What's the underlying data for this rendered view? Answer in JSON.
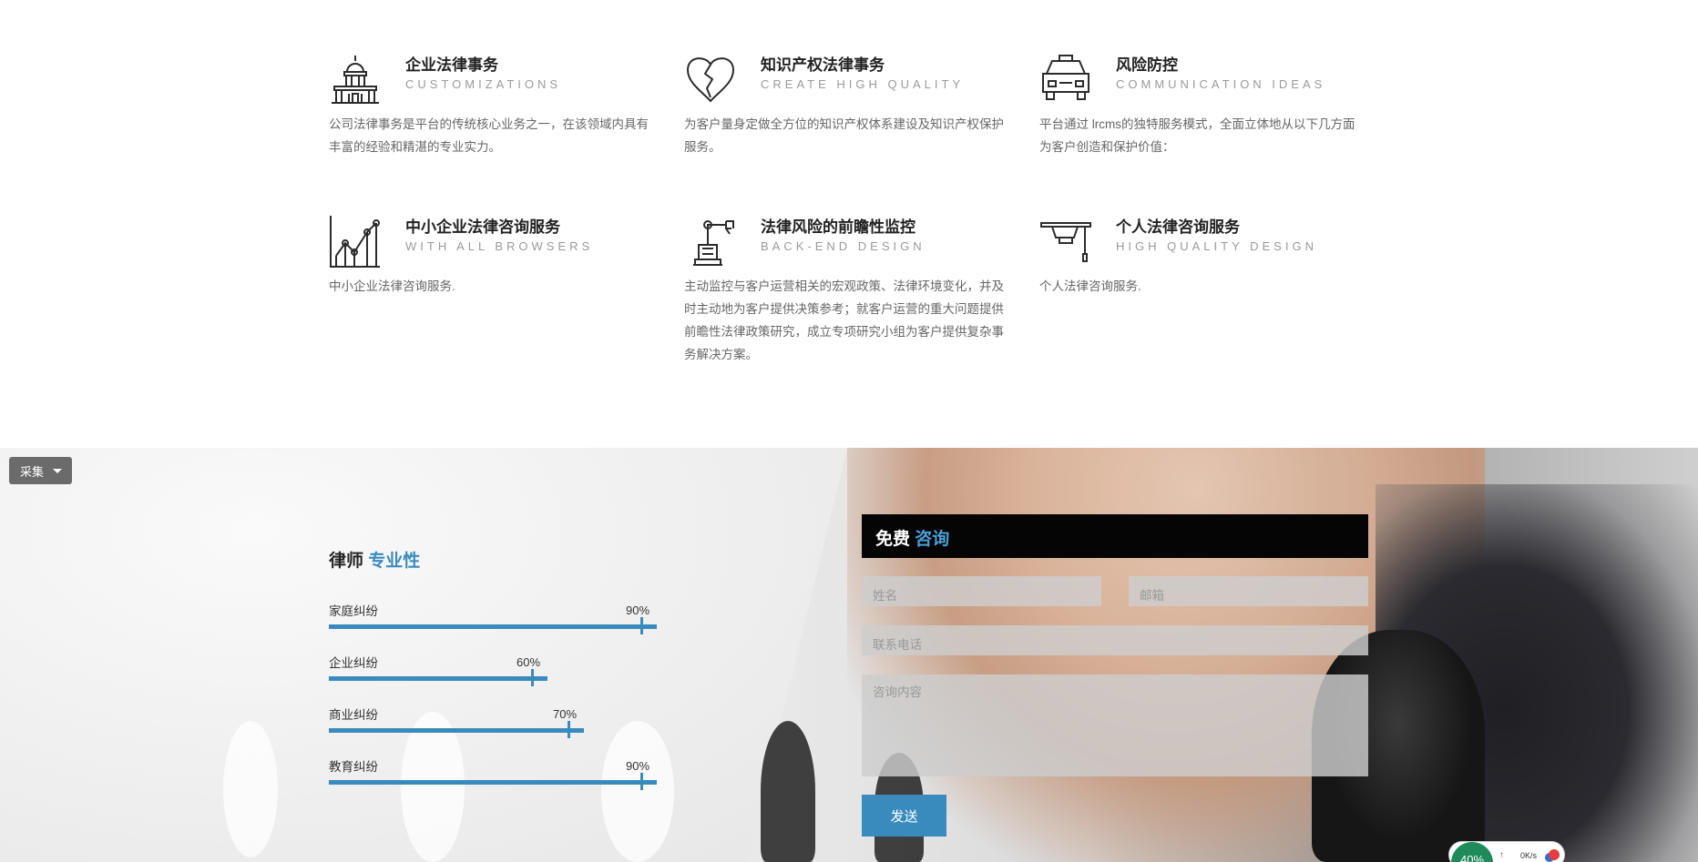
{
  "services": [
    {
      "title": "企业法律事务",
      "subtitle": "CUSTOMIZATIONS",
      "icon": "capitol-building-icon",
      "desc": "公司法律事务是平台的传统核心业务之一，在该领域内具有丰富的经验和精湛的专业实力。"
    },
    {
      "title": "知识产权法律事务",
      "subtitle": "CREATE HIGH QUALITY",
      "icon": "broken-heart-icon",
      "desc": "为客户量身定做全方位的知识产权体系建设及知识产权保护服务。"
    },
    {
      "title": "风险防控",
      "subtitle": "COMMUNICATION IDEAS",
      "icon": "taxi-car-icon",
      "desc": "平台通过 lrcms的独特服务模式，全面立体地从以下几方面为客户创造和保护价值："
    },
    {
      "title": "中小企业法律咨询服务",
      "subtitle": "WITH ALL BROWSERS",
      "icon": "line-chart-icon",
      "desc": "中小企业法律咨询服务."
    },
    {
      "title": "法律风险的前瞻性监控",
      "subtitle": "BACK-END DESIGN",
      "icon": "robot-arm-icon",
      "desc": "主动监控与客户运营相关的宏观政策、法律环境变化，并及时主动地为客户提供决策参考；就客户运营的重大问题提供前瞻性法律政策研究，成立专项研究小组为客户提供复杂事务解决方案。"
    },
    {
      "title": "个人法律咨询服务",
      "subtitle": "HIGH QUALITY DESIGN",
      "icon": "graduation-cap-icon",
      "desc": "个人法律咨询服务."
    }
  ],
  "skills": {
    "title_prefix": "律师",
    "title_accent": "专业性",
    "items": [
      {
        "label": "家庭纠纷",
        "percent": 90,
        "percent_label": "90%"
      },
      {
        "label": "企业纠纷",
        "percent": 60,
        "percent_label": "60%"
      },
      {
        "label": "商业纠纷",
        "percent": 70,
        "percent_label": "70%"
      },
      {
        "label": "教育纠纷",
        "percent": 90,
        "percent_label": "90%"
      }
    ]
  },
  "consult_form": {
    "title_prefix": "免费",
    "title_accent": "咨询",
    "name_placeholder": "姓名",
    "email_placeholder": "邮箱",
    "phone_placeholder": "联系电话",
    "content_placeholder": "咨询内容",
    "send_label": "发送"
  },
  "collect_button": {
    "label": "采集"
  },
  "net_monitor": {
    "percent": "40%",
    "speed": "0K/s"
  },
  "colors": {
    "accent": "#3a8bbd",
    "form_header": "#050505",
    "collect_button": "#6b6b6b"
  }
}
